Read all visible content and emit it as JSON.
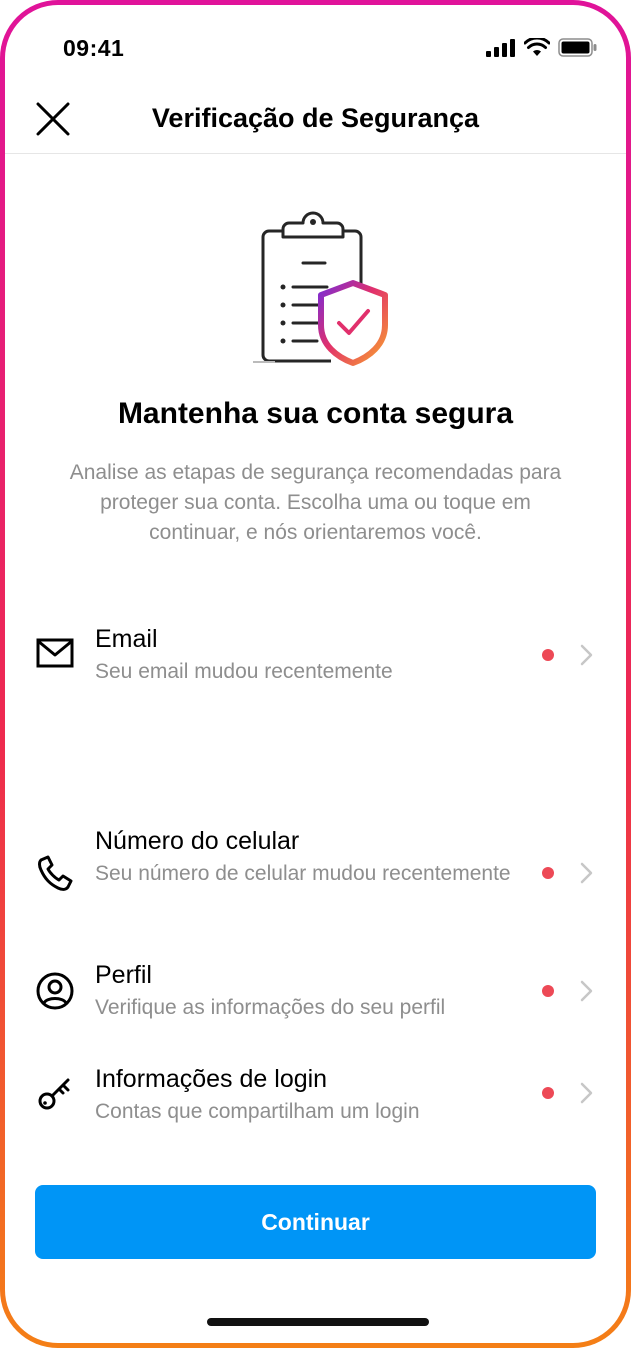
{
  "status_bar": {
    "time": "09:41"
  },
  "header": {
    "title": "Verificação de Segurança"
  },
  "hero": {
    "title": "Mantenha sua conta segura",
    "description": "Analise as etapas de segurança recomendadas para proteger sua conta. Escolha uma ou toque em continuar, e nós orientaremos você."
  },
  "items": [
    {
      "label": "Email",
      "sub": "Seu email mudou recentemente",
      "icon": "mail-icon"
    },
    {
      "label": "Número do celular",
      "sub": "Seu número de celular mudou recentemente",
      "icon": "phone-icon"
    },
    {
      "label": "Perfil",
      "sub": "Verifique as informações do seu perfil",
      "icon": "profile-icon"
    },
    {
      "label": "Informações de login",
      "sub": "Contas que compartilham um login",
      "icon": "key-icon"
    }
  ],
  "continue_button": {
    "label": "Continuar"
  },
  "colors": {
    "accent": "#0095f6",
    "alert_dot": "#ed4956",
    "frame_top": "#e0139a",
    "frame_bottom": "#f47f16"
  }
}
